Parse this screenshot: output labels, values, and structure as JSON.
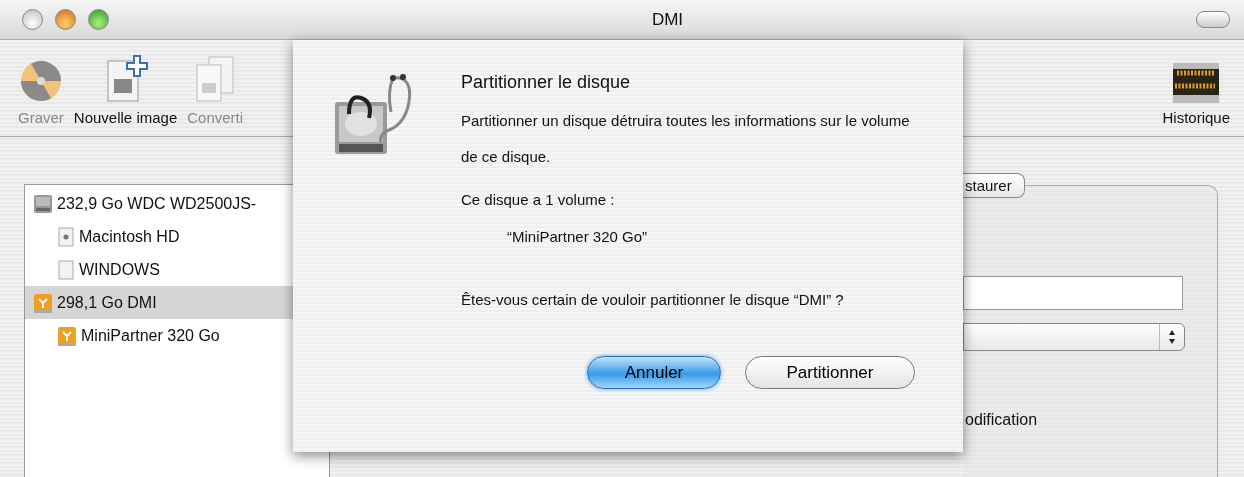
{
  "window": {
    "title": "DMI"
  },
  "toolbar": {
    "items": [
      {
        "label": "Graver",
        "kind": "burn",
        "disabled": true
      },
      {
        "label": "Nouvelle image",
        "kind": "new-image",
        "disabled": false
      },
      {
        "label": "Converti",
        "kind": "convert",
        "disabled": true
      }
    ],
    "right_items": [
      {
        "label": "Historique",
        "kind": "log",
        "disabled": false
      }
    ]
  },
  "sidebar": {
    "items": [
      {
        "label": "232,9 Go WDC WD2500JS-",
        "kind": "disk",
        "selected": false,
        "children": [
          {
            "label": "Macintosh HD",
            "kind": "system-volume",
            "selected": false
          },
          {
            "label": "WINDOWS",
            "kind": "volume",
            "selected": false
          }
        ]
      },
      {
        "label": "298,1 Go DMI",
        "kind": "external",
        "selected": true,
        "children": [
          {
            "label": "MiniPartner 320 Go",
            "kind": "external",
            "selected": false
          }
        ]
      }
    ]
  },
  "detail": {
    "tab_label": "staurer",
    "checkbox_label": "odification"
  },
  "dialog": {
    "title": "Partitionner le disque",
    "message": "Partitionner un disque détruira toutes les informations sur le volume de ce disque.",
    "count_text": "Ce disque a 1 volume :",
    "volume_name": "“MiniPartner 320 Go”",
    "question": "Êtes-vous certain de vouloir partitionner le disque “DMI” ?",
    "buttons": [
      {
        "label": "Annuler",
        "default": true
      },
      {
        "label": "Partitionner",
        "default": false
      }
    ]
  }
}
